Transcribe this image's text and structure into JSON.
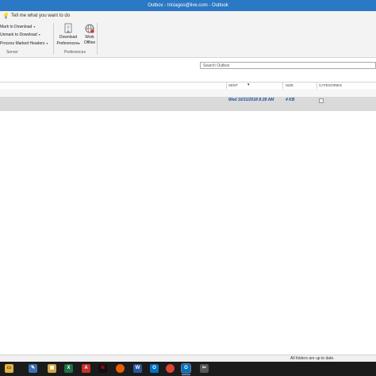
{
  "window": {
    "title": "Outbox - triciagoo@live.com  -  Outlook",
    "controls": "–  ▢  ✕"
  },
  "tell": {
    "text": "Tell me what you want to do"
  },
  "ribbon": {
    "server_items": [
      "Mark to Download",
      "Unmark to Download",
      "Process Marked Headers"
    ],
    "server_label": "Server",
    "download_prefs": [
      "Download",
      "Preferences"
    ],
    "work_offline": [
      "Work",
      "Offline"
    ],
    "preferences_label": "Preferences"
  },
  "search": {
    "placeholder": "Search Outbox"
  },
  "columns": {
    "sent": "SENT",
    "size": "SIZE",
    "categories": "CATEGORIES"
  },
  "messages": [
    {
      "sent": "Wed 10/31/2018 8:28 AM",
      "size": "4 KB"
    }
  ],
  "status": {
    "text": "All folders are up to date."
  },
  "taskbar": {
    "apps": [
      "file-explorer-icon",
      "notepad-icon",
      "files-icon",
      "excel-icon",
      "acrobat-icon",
      "netflix-icon",
      "firefox-icon",
      "word-icon",
      "outlook-icon",
      "chrome-icon",
      "outlook-active-icon",
      "snip-icon"
    ]
  }
}
